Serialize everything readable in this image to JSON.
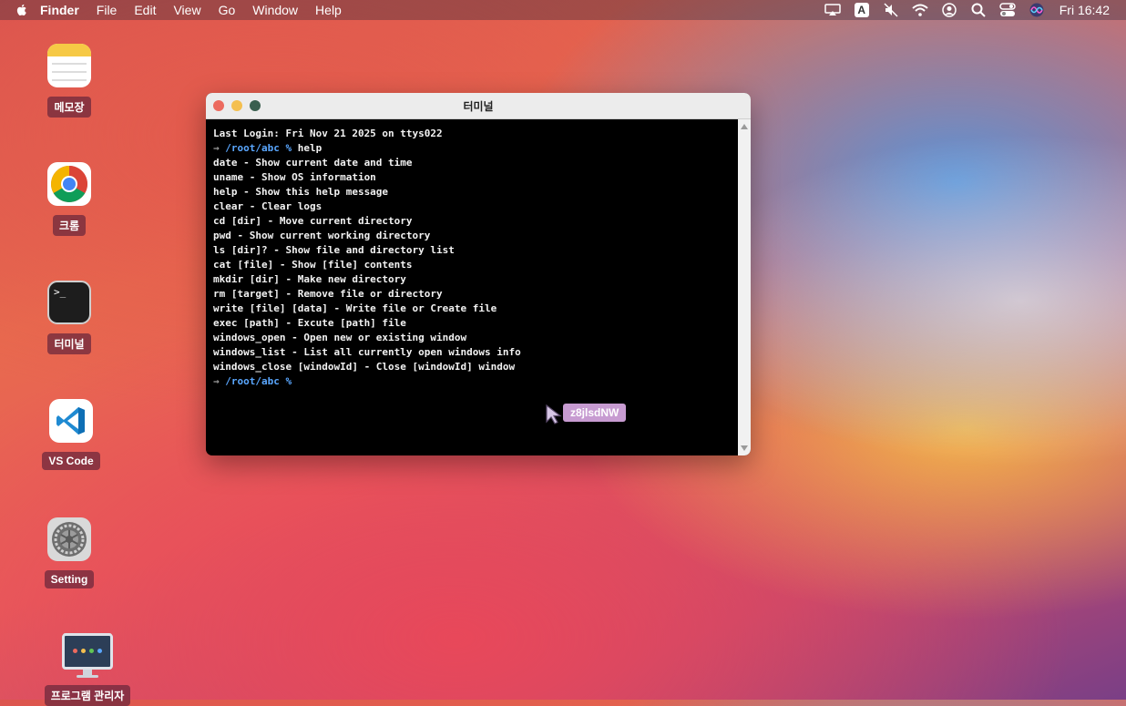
{
  "menubar": {
    "app": "Finder",
    "items": [
      "File",
      "Edit",
      "View",
      "Go",
      "Window",
      "Help"
    ],
    "status_icons": [
      "airplay-icon",
      "input-a-icon",
      "mute-icon",
      "wifi-icon",
      "user-icon",
      "search-icon",
      "control-center-icon",
      "siri-icon"
    ],
    "input_letter": "A",
    "clock": "Fri 16:42"
  },
  "desktop_icons": [
    {
      "label": "메모장",
      "icon": "notes-icon"
    },
    {
      "label": "크롬",
      "icon": "chrome-icon"
    },
    {
      "label": "터미널",
      "icon": "terminal-icon"
    },
    {
      "label": "VS Code",
      "icon": "vscode-icon"
    },
    {
      "label": "Setting",
      "icon": "settings-icon"
    },
    {
      "label": "프로그램 관리자",
      "icon": "program-manager-icon"
    }
  ],
  "terminal": {
    "title": "터미널",
    "last_login": "Last Login: Fri Nov 21 2025 on ttys022",
    "prompt_arrow": "→",
    "prompt_path": "/root/abc %",
    "command": "help",
    "output": [
      "date - Show current date and time",
      "uname - Show OS information",
      "help - Show this help message",
      "clear - Clear logs",
      "cd [dir] - Move current directory",
      "pwd - Show current working directory",
      "ls [dir]? - Show file and directory list",
      "cat [file] - Show [file] contents",
      "mkdir [dir] - Make new directory",
      "rm [target] - Remove file or directory",
      "write [file] [data] - Write file or Create file",
      "exec [path] - Excute [path] file",
      "windows_open - Open new or existing window",
      "windows_list - List all currently open windows info",
      "windows_close [windowId] - Close [windowId] window"
    ]
  },
  "cursor_tag": "z8jlsdNW",
  "colors": {
    "close": "#ec6a5e",
    "minimize": "#f4bf4f",
    "maximize": "#3a5f4f",
    "prompt_path": "#5aa7ff",
    "cursor_tag_bg": "#c79bd1"
  }
}
